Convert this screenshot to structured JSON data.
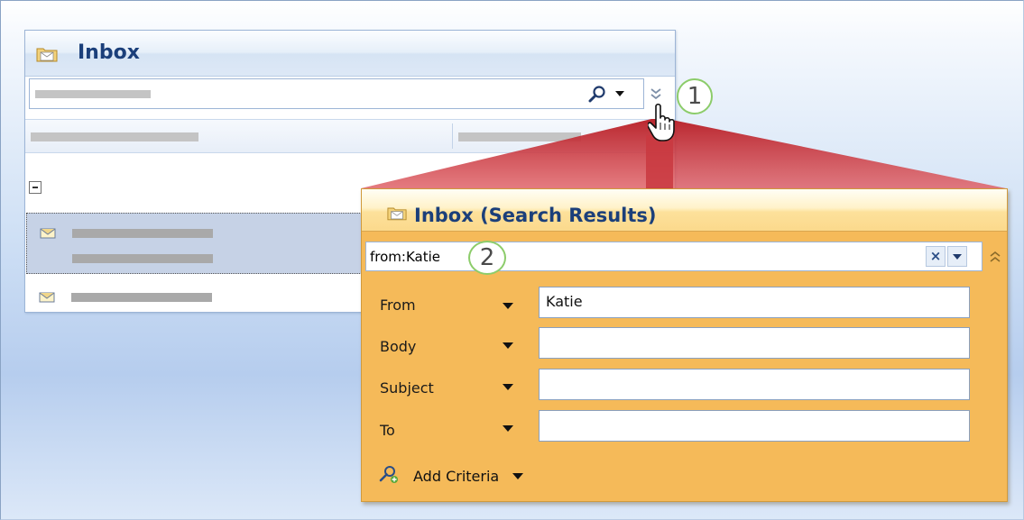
{
  "inbox": {
    "title": "Inbox",
    "icon": "inbox-folder-icon",
    "search_icon": "magnifier-icon",
    "expand_icon": "double-chevron-down-icon",
    "collapse_icon": "minus-box-icon",
    "message_icon": "envelope-icon"
  },
  "callouts": {
    "one": "1",
    "two": "2"
  },
  "search_results": {
    "title": "Inbox (Search Results)",
    "query": "from:Katie",
    "clear_label": "×",
    "collapse_icon": "double-chevron-up-icon",
    "criteria": [
      {
        "label": "From",
        "value": "Katie"
      },
      {
        "label": "Body",
        "value": ""
      },
      {
        "label": "Subject",
        "value": ""
      },
      {
        "label": "To",
        "value": ""
      }
    ],
    "add_criteria_label": "Add Criteria",
    "add_criteria_icon": "add-criteria-icon"
  },
  "colors": {
    "title_text": "#1b3f7a",
    "results_background": "#f5ba59",
    "callout_border": "#8ccc6a",
    "highlight_funnel": "#c0282e"
  }
}
